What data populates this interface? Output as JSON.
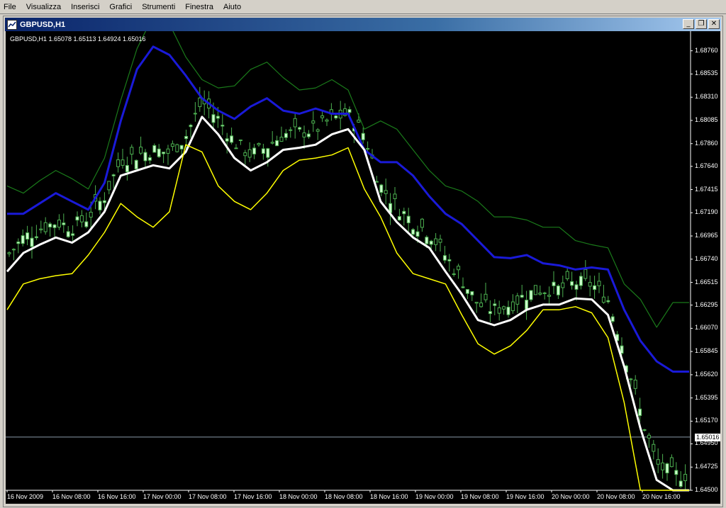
{
  "menu": [
    "File",
    "Visualizza",
    "Inserisci",
    "Grafici",
    "Strumenti",
    "Finestra",
    "Aiuto"
  ],
  "window": {
    "title": "GBPUSD,H1",
    "minimize_glyph": "_",
    "restore_glyph": "❐",
    "close_glyph": "✕"
  },
  "chart_header": "GBPUSD,H1  1.65078 1.65113 1.64924 1.65016",
  "current_price": "1.65016",
  "colors": {
    "background": "#000000",
    "outer_band": "#1a7a1a",
    "blue_band": "#1a1ad8",
    "white_line": "#ffffff",
    "yellow_line": "#ffff00",
    "candle": "#ccffcc",
    "wick": "#4caf50"
  },
  "chart_data": {
    "type": "line",
    "price_axis": [
      "1.68760",
      "1.68535",
      "1.68310",
      "1.68085",
      "1.67860",
      "1.67640",
      "1.67415",
      "1.67190",
      "1.66965",
      "1.66740",
      "1.66515",
      "1.66295",
      "1.66070",
      "1.65845",
      "1.65620",
      "1.65395",
      "1.65170",
      "1.64950",
      "1.64725",
      "1.64500"
    ],
    "time_axis": [
      "16 Nov 2009",
      "16 Nov 08:00",
      "16 Nov 16:00",
      "17 Nov 00:00",
      "17 Nov 08:00",
      "17 Nov 16:00",
      "18 Nov 00:00",
      "18 Nov 08:00",
      "18 Nov 16:00",
      "19 Nov 00:00",
      "19 Nov 08:00",
      "19 Nov 16:00",
      "20 Nov 00:00",
      "20 Nov 08:00",
      "20 Nov 16:00"
    ],
    "ylim": [
      1.645,
      1.6895
    ],
    "series": [
      {
        "color": "#1a7a1a",
        "values": [
          1.6745,
          1.6738,
          1.675,
          1.676,
          1.6752,
          1.6742,
          1.6772,
          1.6828,
          1.6878,
          1.691,
          1.6902,
          1.687,
          1.6848,
          1.684,
          1.6842,
          1.6858,
          1.6865,
          1.685,
          1.6838,
          1.684,
          1.6848,
          1.6838,
          1.68,
          1.6808,
          1.68,
          1.678,
          1.676,
          1.6745,
          1.674,
          1.673,
          1.6715,
          1.6715,
          1.6712,
          1.6705,
          1.6705,
          1.6692,
          1.6688,
          1.6685,
          1.665,
          1.6635,
          1.6608,
          1.6632,
          1.6632
        ]
      },
      {
        "color": "#1a1ad8",
        "values": [
          1.6718,
          1.6718,
          1.6728,
          1.6738,
          1.673,
          1.6722,
          1.6748,
          1.6808,
          1.6858,
          1.688,
          1.6872,
          1.6852,
          1.683,
          1.6818,
          1.681,
          1.6822,
          1.683,
          1.6818,
          1.6815,
          1.682,
          1.6815,
          1.6815,
          1.678,
          1.6768,
          1.6768,
          1.6755,
          1.6735,
          1.6718,
          1.6708,
          1.6692,
          1.6676,
          1.6675,
          1.6678,
          1.667,
          1.6668,
          1.6664,
          1.6666,
          1.6664,
          1.6625,
          1.6595,
          1.6575,
          1.6565,
          1.6565
        ]
      },
      {
        "color": "#ffffff",
        "values": [
          1.6662,
          1.668,
          1.6688,
          1.6695,
          1.669,
          1.67,
          1.672,
          1.6755,
          1.676,
          1.6765,
          1.6762,
          1.6778,
          1.6812,
          1.6795,
          1.6772,
          1.676,
          1.6768,
          1.678,
          1.6782,
          1.6785,
          1.6795,
          1.68,
          1.678,
          1.673,
          1.671,
          1.6695,
          1.6685,
          1.6662,
          1.664,
          1.6615,
          1.661,
          1.6615,
          1.6625,
          1.663,
          1.663,
          1.6636,
          1.6635,
          1.662,
          1.657,
          1.651,
          1.646,
          1.645,
          1.645
        ]
      },
      {
        "color": "#ffff00",
        "values": [
          1.6625,
          1.665,
          1.6655,
          1.6658,
          1.666,
          1.6678,
          1.67,
          1.6728,
          1.6715,
          1.6705,
          1.672,
          1.6785,
          1.6778,
          1.6745,
          1.673,
          1.6722,
          1.6738,
          1.676,
          1.677,
          1.6772,
          1.6775,
          1.6782,
          1.6742,
          1.6715,
          1.668,
          1.666,
          1.6655,
          1.665,
          1.662,
          1.6592,
          1.6582,
          1.659,
          1.6605,
          1.6625,
          1.6625,
          1.6628,
          1.6622,
          1.6598,
          1.6535,
          1.645,
          1.645,
          1.645,
          1.645
        ]
      }
    ]
  }
}
